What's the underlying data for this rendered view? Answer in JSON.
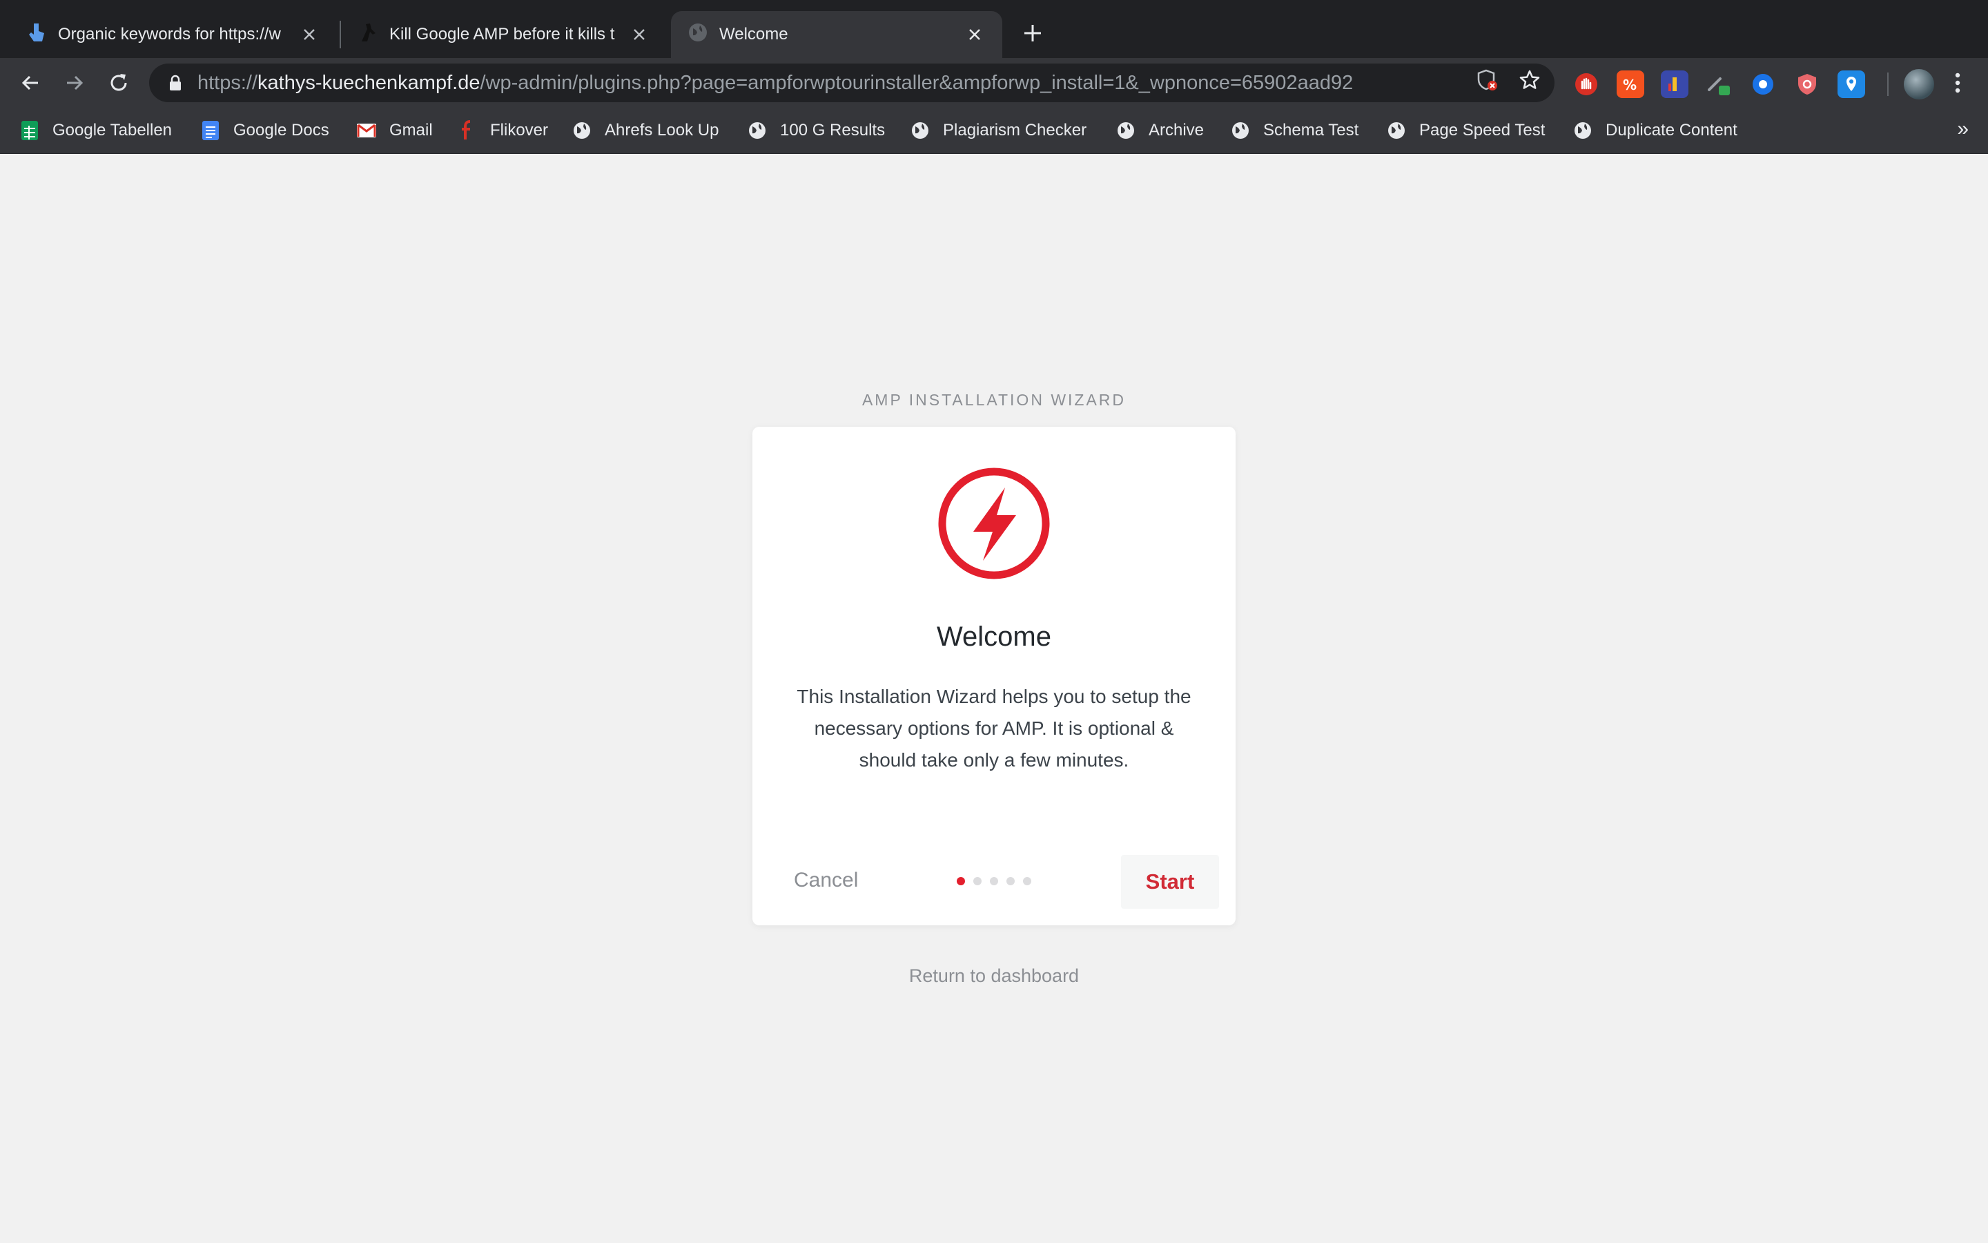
{
  "browser": {
    "tabs": [
      {
        "title": "Organic keywords for https://w",
        "favicon": "ahrefs-hand-icon",
        "active": false
      },
      {
        "title": "Kill Google AMP before it kills t",
        "favicon": "figure-icon",
        "active": false
      },
      {
        "title": "Welcome",
        "favicon": "globe-icon",
        "active": true
      }
    ],
    "address_bar": {
      "protocol": "https://",
      "host": "kathys-kuechenkampf.de",
      "path": "/wp-admin/plugins.php?page=ampforwptourinstaller&ampforwp_install=1&_wpnonce=65902aad92"
    },
    "bookmarks": [
      {
        "label": "Google Tabellen",
        "icon": "sheets-icon"
      },
      {
        "label": "Google Docs",
        "icon": "docs-icon"
      },
      {
        "label": "Gmail",
        "icon": "gmail-icon"
      },
      {
        "label": "Flikover",
        "icon": "flikover-icon"
      },
      {
        "label": "Ahrefs Look Up",
        "icon": "globe-icon"
      },
      {
        "label": "100 G Results",
        "icon": "globe-icon"
      },
      {
        "label": "Plagiarism Checker",
        "icon": "globe-icon"
      },
      {
        "label": "Archive",
        "icon": "globe-icon"
      },
      {
        "label": "Schema Test",
        "icon": "globe-icon"
      },
      {
        "label": "Page Speed Test",
        "icon": "globe-icon"
      },
      {
        "label": "Duplicate Content",
        "icon": "globe-icon"
      }
    ],
    "bookmarks_more": "»"
  },
  "wizard": {
    "heading": "AMP INSTALLATION WIZARD",
    "title": "Welcome",
    "description": "This Installation Wizard helps you to setup the necessary options for AMP. It is optional & should take only a few minutes.",
    "cancel_label": "Cancel",
    "start_label": "Start",
    "steps_total": 5,
    "current_step": 1,
    "return_link": "Return to dashboard",
    "accent_color": "#e31f2d"
  }
}
